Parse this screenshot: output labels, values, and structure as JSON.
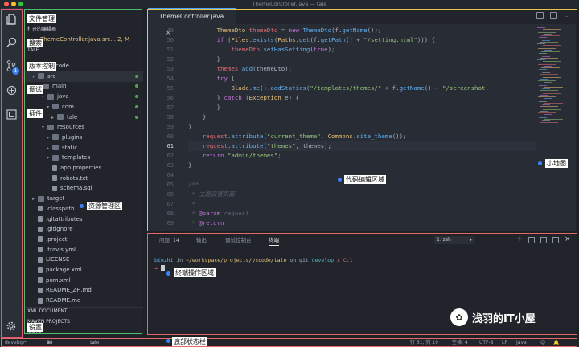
{
  "window": {
    "title": "ThemeController.java — tale"
  },
  "annotations": {
    "file_manager": "文件管理",
    "search": "搜索",
    "version_control": "版本控制",
    "debug": "调试",
    "extensions": "插件",
    "settings": "设置",
    "explorer_area": "资源管理区",
    "code_area": "代码编辑区域",
    "minimap": "小地图",
    "terminal_area": "终端操作区域",
    "status_bar": "底部状态栏"
  },
  "activity": {
    "scm_badge": "1"
  },
  "sidebar": {
    "open_editors_header": "打开的编辑器",
    "open_file": "ThemeController.java src... 2, M",
    "project_header": "TALE",
    "outline_header": "XML DOCUMENT",
    "maven_header": "MAVEN PROJECTS",
    "projects_header": "JECTS",
    "tree": [
      {
        "label": ".vscode",
        "kind": "folder",
        "indent": 2,
        "caret": "▸"
      },
      {
        "label": "src",
        "kind": "folder",
        "indent": 2,
        "caret": "▾",
        "dot": true
      },
      {
        "label": "main",
        "kind": "folder",
        "indent": 3,
        "caret": "▾",
        "dot": true
      },
      {
        "label": "java",
        "kind": "folder",
        "indent": 4,
        "caret": "▾",
        "dot": true
      },
      {
        "label": "com",
        "kind": "folder",
        "indent": 5,
        "caret": "▾",
        "dot": true
      },
      {
        "label": "tale",
        "kind": "folder",
        "indent": 6,
        "caret": "▸",
        "dot": true
      },
      {
        "label": "resources",
        "kind": "folder",
        "indent": 4,
        "caret": "▾"
      },
      {
        "label": "plugins",
        "kind": "folder",
        "indent": 5,
        "caret": "▸"
      },
      {
        "label": "static",
        "kind": "folder",
        "indent": 5,
        "caret": "▸"
      },
      {
        "label": "templates",
        "kind": "folder",
        "indent": 5,
        "caret": "▸"
      },
      {
        "label": "app.properties",
        "kind": "file",
        "indent": 5,
        "caret": ""
      },
      {
        "label": "robots.txt",
        "kind": "file",
        "indent": 5,
        "caret": ""
      },
      {
        "label": "schema.sql",
        "kind": "file",
        "indent": 5,
        "caret": ""
      },
      {
        "label": "target",
        "kind": "folder",
        "indent": 2,
        "caret": "▸"
      },
      {
        "label": ".classpath",
        "kind": "file",
        "indent": 2,
        "caret": ""
      },
      {
        "label": ".gitattributes",
        "kind": "file",
        "indent": 2,
        "caret": ""
      },
      {
        "label": ".gitignore",
        "kind": "file",
        "indent": 2,
        "caret": ""
      },
      {
        "label": ".project",
        "kind": "file",
        "indent": 2,
        "caret": ""
      },
      {
        "label": ".travis.yml",
        "kind": "file",
        "indent": 2,
        "caret": ""
      },
      {
        "label": "LICENSE",
        "kind": "file",
        "indent": 2,
        "caret": ""
      },
      {
        "label": "package.xml",
        "kind": "file",
        "indent": 2,
        "caret": ""
      },
      {
        "label": "pom.xml",
        "kind": "file",
        "indent": 2,
        "caret": ""
      },
      {
        "label": "README_ZH.md",
        "kind": "file",
        "indent": 2,
        "caret": ""
      },
      {
        "label": "README.md",
        "kind": "file",
        "indent": 2,
        "caret": ""
      }
    ]
  },
  "editor": {
    "tab_label": "ThemeController.java",
    "line_numbers": [
      "49",
      "50",
      "51",
      "52",
      "53",
      "54",
      "55",
      "56",
      "57",
      "58",
      "59",
      "60",
      "61",
      "62",
      "63",
      "64",
      "65",
      "66",
      "67",
      "68",
      "69"
    ],
    "current_line": "61"
  },
  "panel": {
    "tabs": [
      "问题",
      "输出",
      "调试控制台",
      "终端"
    ],
    "problems_count": "14",
    "terminal_select": "1: zsh",
    "prompt_user": "biezhi",
    "prompt_in": " in ",
    "prompt_path": "~/workspace/projects/vscode/tale",
    "prompt_on": " on git:",
    "prompt_branch": "develop",
    "prompt_status": " x C:1",
    "prompt_caret": "→"
  },
  "statusbar": {
    "branch": "develop*",
    "errors": "0",
    "warnings": "14",
    "folder": "tale",
    "position": "行 61, 列 19",
    "spaces": "空格: 4",
    "encoding": "UTF-8",
    "eol": "LF",
    "language": "Java"
  },
  "watermark": {
    "text": "浅羽的IT小屋"
  }
}
